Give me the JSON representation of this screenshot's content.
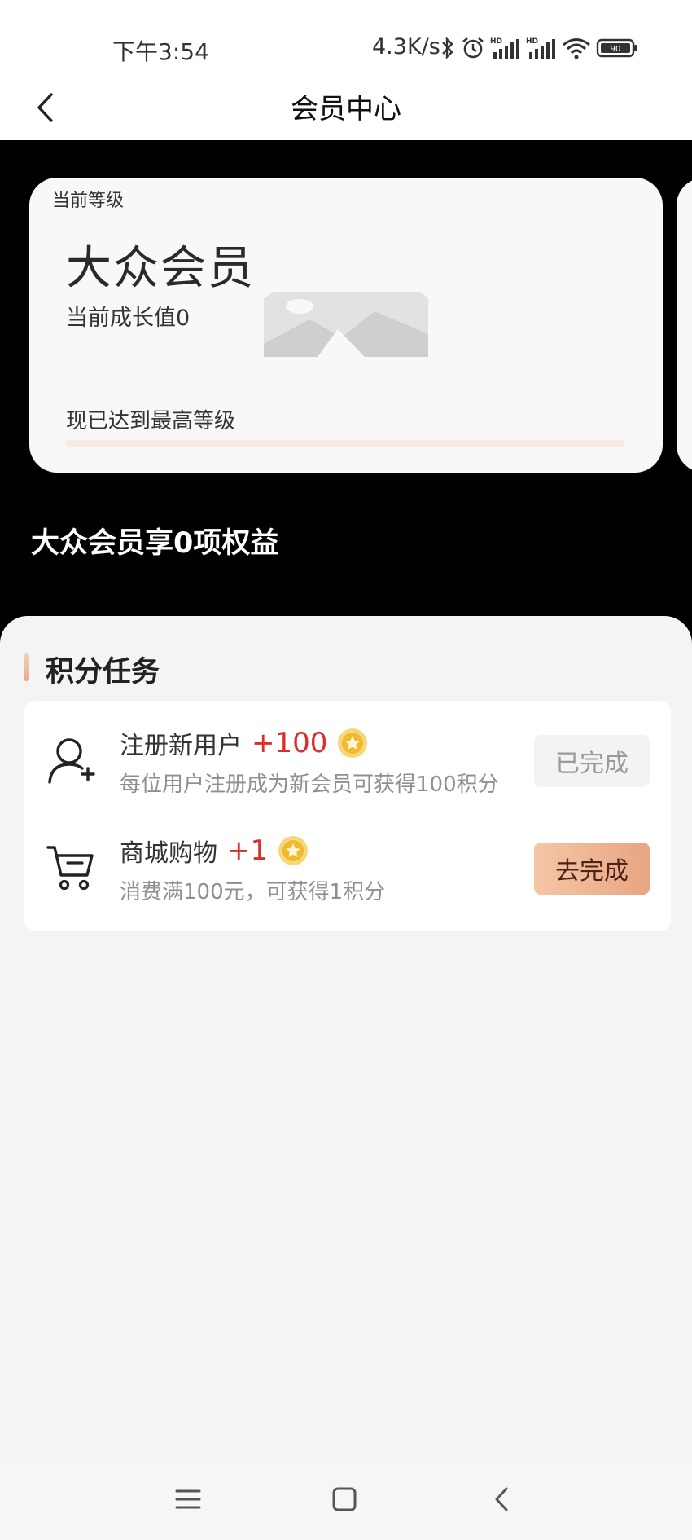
{
  "status_bar": {
    "time": "下午3:54",
    "network_speed": "4.3K/s",
    "battery": "90",
    "icons": [
      "bluetooth-icon",
      "alarm-icon",
      "hd-signal-icon",
      "hd-signal-icon",
      "wifi-icon",
      "battery-icon"
    ]
  },
  "header": {
    "title": "会员中心",
    "back_icon": "chevron-left-icon"
  },
  "level_card": {
    "caption": "当前等级",
    "level_name": "大众会员",
    "growth_value": "当前成长值0",
    "status": "现已达到最高等级",
    "progress": 0
  },
  "benefits": {
    "title": "大众会员享0项权益"
  },
  "tasks": {
    "section_title": "积分任务",
    "items": [
      {
        "name": "注册新用户",
        "points": "+100",
        "description": "每位用户注册成为新会员可获得100积分",
        "button": "已完成",
        "icon": "add-user-icon",
        "completed": true
      },
      {
        "name": "商城购物",
        "points": "+1",
        "description": "消费满100元，可获得1积分",
        "button": "去完成",
        "icon": "cart-icon",
        "completed": false
      }
    ]
  },
  "colors": {
    "accent_red": "#d9302b",
    "button_gradient_start": "#f5c6a6",
    "button_gradient_end": "#e8a582",
    "hero_background": "#000000"
  },
  "nav_bar": {
    "icons": [
      "menu-icon",
      "home-icon",
      "back-icon"
    ]
  }
}
